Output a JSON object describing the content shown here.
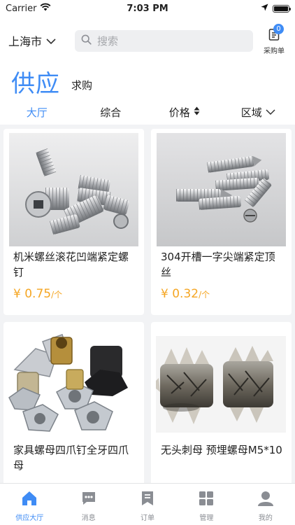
{
  "statusbar": {
    "carrier": "Carrier",
    "time": "7:03 PM",
    "battery_level": 1.0
  },
  "header": {
    "city": "上海市",
    "search_placeholder": "搜索",
    "cart_label": "采购单",
    "cart_count": "0"
  },
  "mode": {
    "active": "供应",
    "other": "求购"
  },
  "filters": [
    {
      "label": "大厅",
      "active": true
    },
    {
      "label": "综合"
    },
    {
      "label": "价格"
    },
    {
      "label": "区域"
    }
  ],
  "products": [
    {
      "title": "机米螺丝滚花凹端紧定螺钉",
      "price": "¥ 0.75",
      "unit": "/个"
    },
    {
      "title": "304开槽一字尖端紧定顶丝",
      "price": "¥ 0.32",
      "unit": "/个"
    },
    {
      "title": "家具螺母四爪钉全牙四爪母"
    },
    {
      "title": "无头刺母 预埋螺母M5*10"
    }
  ],
  "tabbar": [
    {
      "label": "供应大厅",
      "icon": "home-icon",
      "active": true
    },
    {
      "label": "消息",
      "icon": "message-icon"
    },
    {
      "label": "订单",
      "icon": "order-icon"
    },
    {
      "label": "管理",
      "icon": "grid-icon"
    },
    {
      "label": "我的",
      "icon": "profile-icon"
    }
  ],
  "colors": {
    "accent": "#3f8cf5",
    "price": "#f5a623",
    "background": "#f2f3f5"
  }
}
